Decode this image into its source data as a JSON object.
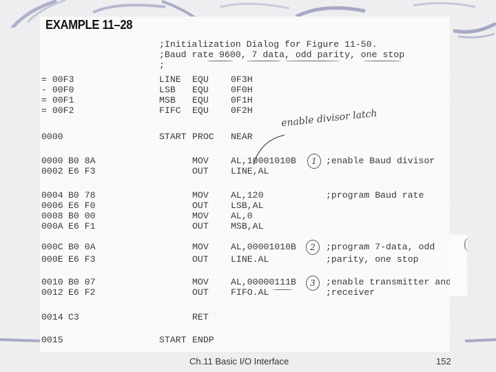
{
  "slide": {
    "footer_title": "Ch.11 Basic I/O Interface",
    "page_number": "152",
    "accent_color": "#a6a8c6"
  },
  "document": {
    "example_title": "EXAMPLE 11–28",
    "header_comments": [
      ";Initialization Dialog for Figure 11-50.",
      ";Baud rate 9600, 7 data, odd parity, one stop",
      ";"
    ],
    "equates": [
      {
        "value": "= 00F3",
        "label": "LINE",
        "op": "EQU",
        "operand": "0F3H"
      },
      {
        "value": "- 00F0",
        "label": "LSB",
        "op": "EQU",
        "operand": "0F0H"
      },
      {
        "value": "= 00F1",
        "label": "MSB",
        "op": "EQU",
        "operand": "0F1H"
      },
      {
        "value": "= 00F2",
        "label": "FIFC",
        "op": "EQU",
        "operand": "0F2H"
      }
    ],
    "proc_start": {
      "address": "0000",
      "label": "START",
      "op": "PROC",
      "operand": "NEAR"
    },
    "instructions": [
      {
        "address": "0000",
        "bytes": "B0 8A",
        "mnemonic": "MOV",
        "operands": "AL,10001010B",
        "comment": ";enable Baud divisor"
      },
      {
        "address": "0002",
        "bytes": "E6 F3",
        "mnemonic": "OUT",
        "operands": "LINE,AL",
        "comment": ""
      },
      {
        "address": "0004",
        "bytes": "B0 78",
        "mnemonic": "MOV",
        "operands": "AL,120",
        "comment": ";program Baud rate"
      },
      {
        "address": "0006",
        "bytes": "E6 F0",
        "mnemonic": "OUT",
        "operands": "LSB,AL",
        "comment": ""
      },
      {
        "address": "0008",
        "bytes": "B0 00",
        "mnemonic": "MOV",
        "operands": "AL,0",
        "comment": ""
      },
      {
        "address": "000A",
        "bytes": "E6 F1",
        "mnemonic": "OUT",
        "operands": "MSB,AL",
        "comment": ""
      },
      {
        "address": "000C",
        "bytes": "B0 0A",
        "mnemonic": "MOV",
        "operands": "AL,00001010B",
        "comment": ";program 7-data, odd"
      },
      {
        "address": "000E",
        "bytes": "E6 F3",
        "mnemonic": "OUT",
        "operands": "LINE.AL",
        "comment": ";parity, one stop"
      },
      {
        "address": "0010",
        "bytes": "B0 07",
        "mnemonic": "MOV",
        "operands": "AL,00000111B",
        "comment": ";enable transmitter and"
      },
      {
        "address": "0012",
        "bytes": "E6 F2",
        "mnemonic": "OUT",
        "operands": "FIFO.AL",
        "comment": ";receiver"
      },
      {
        "address": "0014",
        "bytes": "C3",
        "mnemonic": "RET",
        "operands": "",
        "comment": ""
      }
    ],
    "proc_end": {
      "address": "0015",
      "label": "START",
      "op": "ENDP"
    },
    "handwritten": {
      "note": "enable divisor latch",
      "circle_1": "1",
      "circle_2": "2",
      "circle_3": "3"
    }
  }
}
